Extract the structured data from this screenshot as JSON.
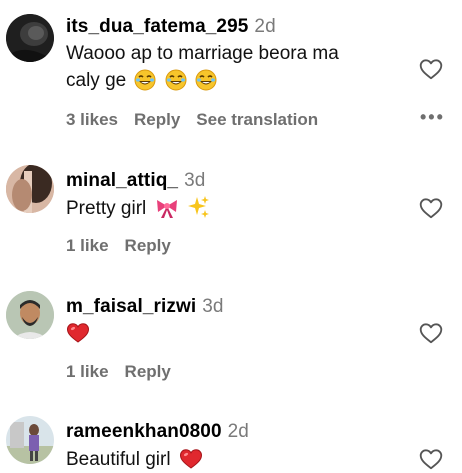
{
  "comments": [
    {
      "username": "its_dua_fatema_295",
      "time": "2d",
      "text_line1": "Waooo ap to marriage beora ma",
      "text_line2": "caly ge",
      "emoji": [
        "laughing-emoji",
        "laughing-emoji",
        "laughing-emoji"
      ],
      "likes": "3 likes",
      "reply": "Reply",
      "see_translation": "See translation",
      "more": "•••"
    },
    {
      "username": "minal_attiq_",
      "time": "3d",
      "text": "Pretty girl",
      "emoji": [
        "ribbon-emoji",
        "sparkles-emoji"
      ],
      "likes": "1 like",
      "reply": "Reply"
    },
    {
      "username": "m_faisal_rizwi",
      "time": "3d",
      "text": "",
      "emoji": [
        "red-heart-emoji"
      ],
      "likes": "1 like",
      "reply": "Reply"
    },
    {
      "username": "rameenkhan0800",
      "time": "2d",
      "text": "Beautiful girl",
      "emoji": [
        "red-heart-emoji"
      ]
    }
  ],
  "colors": {
    "secondary_text": "#6f6f6f",
    "timestamp": "#7a7a7a",
    "heart_emoji": "#e0282e"
  }
}
